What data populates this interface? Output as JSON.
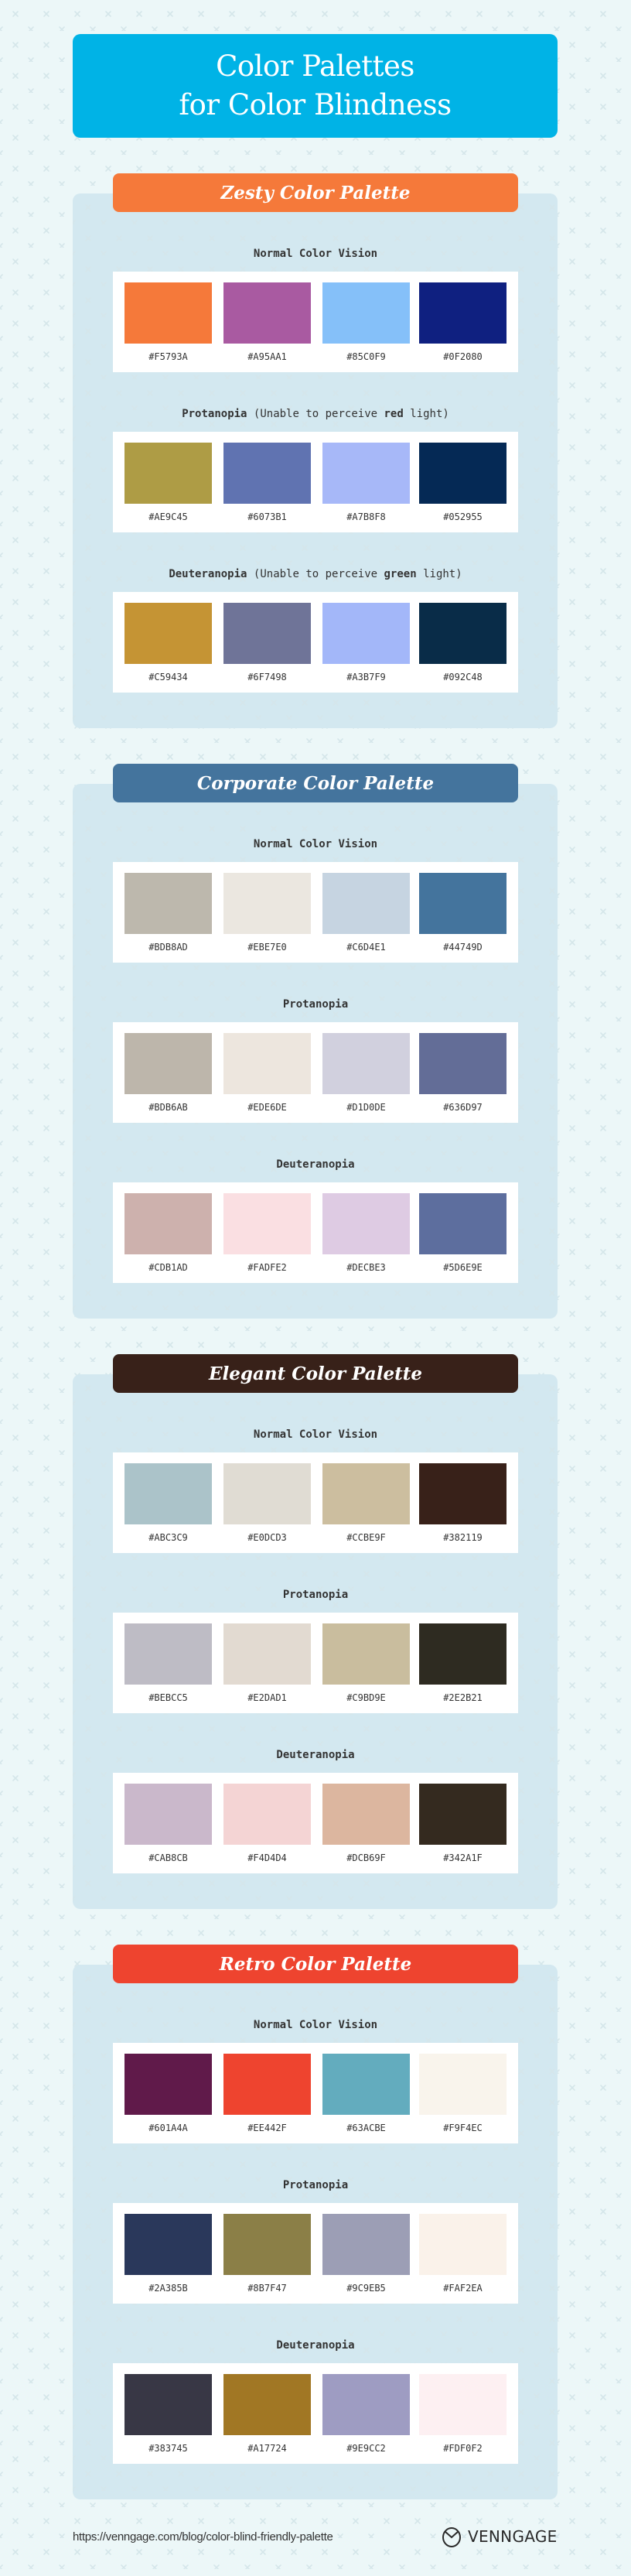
{
  "title": {
    "line1": "Color Palettes",
    "line2": "for Color Blindness",
    "bg_color": "#00B3E6"
  },
  "palettes": [
    {
      "name": "Zesty Color Palette",
      "header_color": "#F5793A",
      "rows": [
        {
          "label": "Normal Color Vision",
          "label_bold": "Normal Color Vision",
          "label_rest": "",
          "colors": [
            "#F5793A",
            "#A95AA1",
            "#85C0F9",
            "#0F2080"
          ]
        },
        {
          "label": "Protanopia (Unable to perceive red light)",
          "label_bold": "Protanopia",
          "label_rest_pre": " (Unable to perceive ",
          "label_emph": "red",
          "label_rest_post": " light)",
          "colors": [
            "#AE9C45",
            "#6073B1",
            "#A7B8F8",
            "#052955"
          ]
        },
        {
          "label": "Deuteranopia (Unable to perceive green light)",
          "label_bold": "Deuteranopia",
          "label_rest_pre": " (Unable to perceive ",
          "label_emph": "green",
          "label_rest_post": " light)",
          "colors": [
            "#C59434",
            "#6F7498",
            "#A3B7F9",
            "#092C48"
          ]
        }
      ]
    },
    {
      "name": "Corporate Color Palette",
      "header_color": "#44749D",
      "rows": [
        {
          "label": "Normal Color Vision",
          "label_bold": "Normal Color Vision",
          "colors": [
            "#BDB8AD",
            "#EBE7E0",
            "#C6D4E1",
            "#44749D"
          ]
        },
        {
          "label": "Protanopia",
          "label_bold": "Protanopia",
          "colors": [
            "#BDB6AB",
            "#EDE6DE",
            "#D1D0DE",
            "#636D97"
          ]
        },
        {
          "label": "Deuteranopia",
          "label_bold": "Deuteranopia",
          "colors": [
            "#CDB1AD",
            "#FADFE2",
            "#DECBE3",
            "#5D6E9E"
          ]
        }
      ]
    },
    {
      "name": "Elegant Color Palette",
      "header_color": "#382119",
      "rows": [
        {
          "label": "Normal Color Vision",
          "label_bold": "Normal Color Vision",
          "colors": [
            "#ABC3C9",
            "#E0DCD3",
            "#CCBE9F",
            "#382119"
          ]
        },
        {
          "label": "Protanopia",
          "label_bold": "Protanopia",
          "colors": [
            "#BEBCC5",
            "#E2DAD1",
            "#C9BD9E",
            "#2E2B21"
          ]
        },
        {
          "label": "Deuteranopia",
          "label_bold": "Deuteranopia",
          "colors": [
            "#CAB8CB",
            "#F4D4D4",
            "#DCB69F",
            "#342A1F"
          ]
        }
      ]
    },
    {
      "name": "Retro Color Palette",
      "header_color": "#EE442F",
      "rows": [
        {
          "label": "Normal Color Vision",
          "label_bold": "Normal Color Vision",
          "colors": [
            "#601A4A",
            "#EE442F",
            "#63ACBE",
            "#F9F4EC"
          ]
        },
        {
          "label": "Protanopia",
          "label_bold": "Protanopia",
          "colors": [
            "#2A385B",
            "#8B7F47",
            "#9C9EB5",
            "#FAF2EA"
          ]
        },
        {
          "label": "Deuteranopia",
          "label_bold": "Deuteranopia",
          "colors": [
            "#383745",
            "#A17724",
            "#9E9CC2",
            "#FDF0F2"
          ]
        }
      ]
    }
  ],
  "footer": {
    "url": "https://venngage.com/blog/color-blind-friendly-palette",
    "brand": "VENNGAGE",
    "brand_icon": "venngage-logo-icon"
  }
}
